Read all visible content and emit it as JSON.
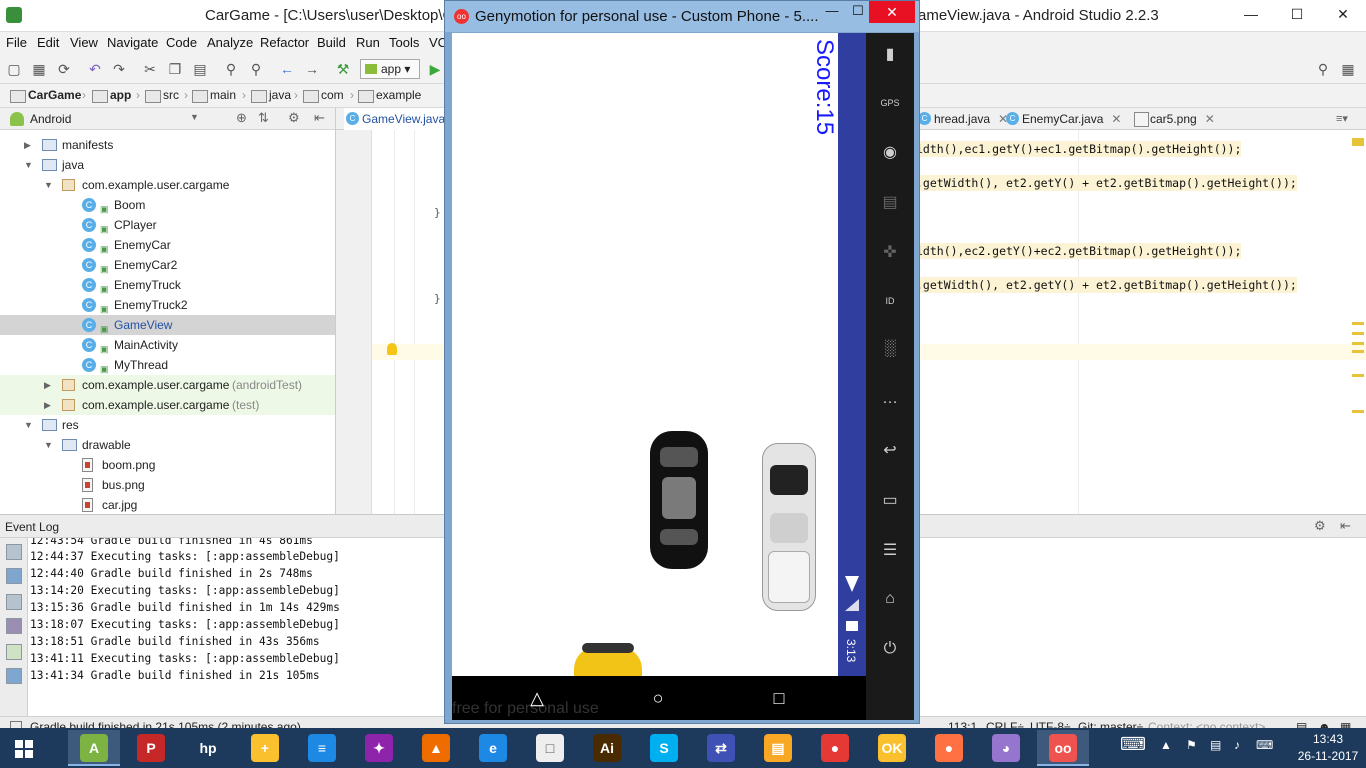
{
  "android_studio": {
    "title_left": "CarGame - [C:\\Users\\user\\Desktop\\C",
    "title_right": "ameView.java - Android Studio 2.2.3",
    "window_controls": [
      "—",
      "☐",
      "✕"
    ],
    "menu": [
      "File",
      "Edit",
      "View",
      "Navigate",
      "Code",
      "Analyze",
      "Refactor",
      "Build",
      "Run",
      "Tools",
      "VC"
    ],
    "toolbar_run_config": "app",
    "breadcrumbs": [
      "CarGame",
      "app",
      "src",
      "main",
      "java",
      "com",
      "example"
    ],
    "project_view": "Android",
    "tree": [
      {
        "label": "manifests",
        "kind": "folder",
        "depth": 1,
        "arrow": "▶"
      },
      {
        "label": "java",
        "kind": "folder",
        "depth": 1,
        "arrow": "▼"
      },
      {
        "label": "com.example.user.cargame",
        "kind": "package",
        "depth": 2,
        "arrow": "▼"
      },
      {
        "label": "Boom",
        "kind": "class",
        "depth": 3
      },
      {
        "label": "CPlayer",
        "kind": "class",
        "depth": 3
      },
      {
        "label": "EnemyCar",
        "kind": "class",
        "depth": 3
      },
      {
        "label": "EnemyCar2",
        "kind": "class",
        "depth": 3
      },
      {
        "label": "EnemyTruck",
        "kind": "class",
        "depth": 3
      },
      {
        "label": "EnemyTruck2",
        "kind": "class",
        "depth": 3
      },
      {
        "label": "GameView",
        "kind": "class",
        "depth": 3,
        "selected": true
      },
      {
        "label": "MainActivity",
        "kind": "class",
        "depth": 3
      },
      {
        "label": "MyThread",
        "kind": "class",
        "depth": 3
      },
      {
        "label": "com.example.user.cargame",
        "suffix": "(androidTest)",
        "kind": "package",
        "depth": 2,
        "arrow": "▶",
        "tested": true
      },
      {
        "label": "com.example.user.cargame",
        "suffix": "(test)",
        "kind": "package",
        "depth": 2,
        "arrow": "▶",
        "tested": true
      },
      {
        "label": "res",
        "kind": "folder",
        "depth": 1,
        "arrow": "▼"
      },
      {
        "label": "drawable",
        "kind": "folder",
        "depth": 2,
        "arrow": "▼"
      },
      {
        "label": "boom.png",
        "kind": "file",
        "depth": 3
      },
      {
        "label": "bus.png",
        "kind": "file",
        "depth": 3
      },
      {
        "label": "car.jpg",
        "kind": "file",
        "depth": 3
      }
    ],
    "editor_tabs": [
      {
        "label": "GameView.java",
        "active": true,
        "file": false
      },
      {
        "label": "hread.java",
        "active": false,
        "file": false
      },
      {
        "label": "EnemyCar.java",
        "active": false,
        "file": false
      },
      {
        "label": "car5.png",
        "active": false,
        "file": true
      }
    ],
    "code_lines": [
      "idth(),ec1.getY()+ec1.getBitmap().getHeight());",
      ".getWidth(), et2.getY() + et2.getBitmap().getHeight());",
      "idth(),ec2.getY()+ec2.getBitmap().getHeight());",
      ".getWidth(), et2.getY() + et2.getBitmap().getHeight());"
    ],
    "event_log_title": "Event Log",
    "event_log": [
      "12:43:54 Gradle build finished in 4s 861ms",
      "12:44:37 Executing tasks: [:app:assembleDebug]",
      "12:44:40 Gradle build finished in 2s 748ms",
      "13:14:20 Executing tasks: [:app:assembleDebug]",
      "13:15:36 Gradle build finished in 1m 14s 429ms",
      "13:18:07 Executing tasks: [:app:assembleDebug]",
      "13:18:51 Gradle build finished in 43s 356ms",
      "13:41:11 Executing tasks: [:app:assembleDebug]",
      "13:41:34 Gradle build finished in 21s 105ms"
    ],
    "status": {
      "message": "Gradle build finished in 21s 105ms (2 minutes ago)",
      "position": "113:1",
      "line_sep": "CRLF÷",
      "encoding": "UTF-8÷",
      "git": "Git: master÷",
      "context": "Context: <no context>"
    }
  },
  "genymotion": {
    "title": "Genymotion for personal use - Custom Phone - 5....",
    "logo": "oo",
    "controls": [
      "—",
      "☐",
      "✕"
    ],
    "score": "Score:15",
    "clock": "3:13",
    "watermark": "free for personal use",
    "nav": [
      "△",
      "○",
      "□",
      "•••"
    ],
    "side_tools": [
      {
        "icon": "battery-icon",
        "glyph": "▮"
      },
      {
        "icon": "gps-icon",
        "glyph": "GPS"
      },
      {
        "icon": "webcam-icon",
        "glyph": "◉"
      },
      {
        "icon": "media-icon",
        "glyph": "▤"
      },
      {
        "icon": "dpad-icon",
        "glyph": "✜"
      },
      {
        "icon": "id-icon",
        "glyph": "ID"
      },
      {
        "icon": "rss-icon",
        "glyph": "░"
      },
      {
        "icon": "sms-icon",
        "glyph": "…"
      },
      {
        "icon": "back-icon",
        "glyph": "↩"
      },
      {
        "icon": "recent-apps-icon",
        "glyph": "▭"
      },
      {
        "icon": "menu-icon",
        "glyph": "☰"
      },
      {
        "icon": "home-icon",
        "glyph": "⌂"
      },
      {
        "icon": "power-icon",
        "glyph": "⏻"
      }
    ]
  },
  "taskbar": {
    "apps": [
      {
        "name": "android-studio",
        "glyph": "A",
        "color": "#7cb342",
        "active": true
      },
      {
        "name": "pdf",
        "glyph": "P",
        "color": "#c62828"
      },
      {
        "name": "hp",
        "glyph": "hp",
        "color": "#1d3a5c"
      },
      {
        "name": "add",
        "glyph": "+",
        "color": "#fbc02d"
      },
      {
        "name": "wifi",
        "glyph": "≡",
        "color": "#1e88e5"
      },
      {
        "name": "puzzle",
        "glyph": "✦",
        "color": "#8e24aa"
      },
      {
        "name": "vlc",
        "glyph": "▲",
        "color": "#ef6c00"
      },
      {
        "name": "ie",
        "glyph": "e",
        "color": "#1e88e5"
      },
      {
        "name": "doc",
        "glyph": "□",
        "color": "#eeeeee"
      },
      {
        "name": "illustrator",
        "glyph": "Ai",
        "color": "#4a2a00"
      },
      {
        "name": "skype",
        "glyph": "S",
        "color": "#00aff0"
      },
      {
        "name": "network",
        "glyph": "⇄",
        "color": "#3f51b5"
      },
      {
        "name": "explorer",
        "glyph": "▤",
        "color": "#f9a825"
      },
      {
        "name": "chrome",
        "glyph": "●",
        "color": "#e53935"
      },
      {
        "name": "ok",
        "glyph": "OK",
        "color": "#fbc02d"
      },
      {
        "name": "firefox",
        "glyph": "●",
        "color": "#ff7043"
      },
      {
        "name": "github",
        "glyph": "◕",
        "color": "#9575cd"
      },
      {
        "name": "genymotion",
        "glyph": "oo",
        "color": "#ef5350",
        "active": true
      }
    ],
    "time": "13:43",
    "date": "26-11-2017"
  }
}
